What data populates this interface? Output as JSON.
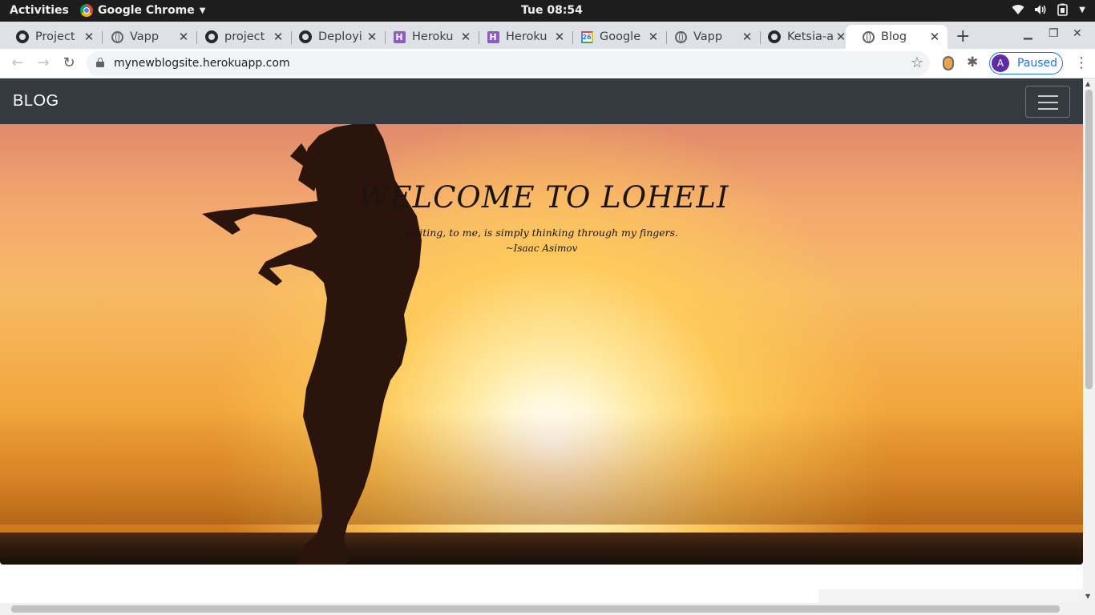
{
  "desktop": {
    "activities": "Activities",
    "app_name": "Google Chrome",
    "clock": "Tue 08:54"
  },
  "tabs": [
    {
      "title": "Project",
      "icon": "github-icon"
    },
    {
      "title": "Vapp",
      "icon": "globe-icon"
    },
    {
      "title": "project",
      "icon": "github-icon"
    },
    {
      "title": "Deployi",
      "icon": "github-icon"
    },
    {
      "title": "Heroku",
      "icon": "heroku-icon"
    },
    {
      "title": "Heroku",
      "icon": "heroku-icon"
    },
    {
      "title": "Google",
      "icon": "google-calendar-icon"
    },
    {
      "title": "Vapp",
      "icon": "globe-icon"
    },
    {
      "title": "Ketsia-a",
      "icon": "github-icon"
    },
    {
      "title": "Blog",
      "icon": "globe-icon",
      "active": true
    }
  ],
  "gcal_day": "26",
  "toolbar": {
    "url": "mynewblogsite.herokuapp.com",
    "profile_initial": "A",
    "profile_label": "Paused"
  },
  "site": {
    "brand": "BLOG",
    "headline": "WELCOME TO LOHELI",
    "quote": "Writing, to me, is simply thinking through my fingers.",
    "author": "~Isaac Asimov"
  },
  "colors": {
    "navbar": "#343a40",
    "profile_accent": "#1a73e8"
  }
}
